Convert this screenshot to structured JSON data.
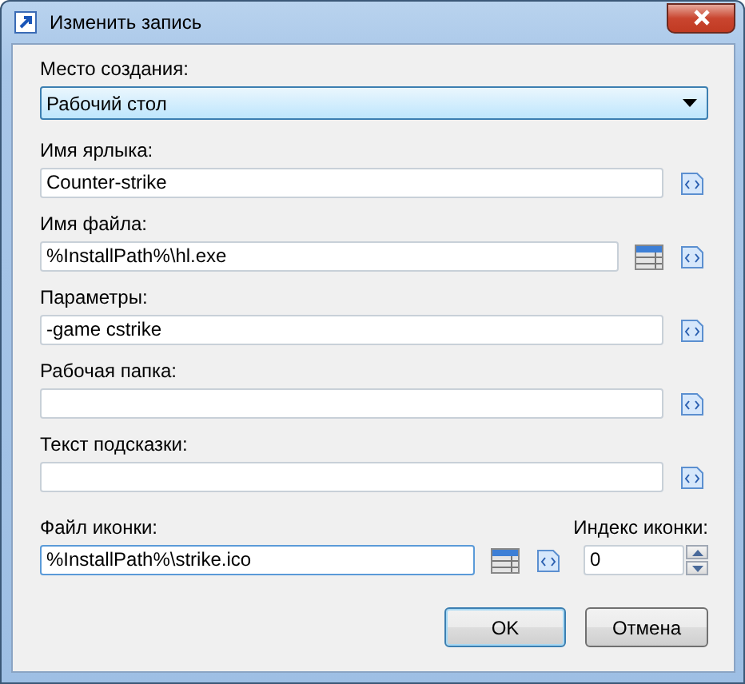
{
  "window": {
    "title": "Изменить запись"
  },
  "location": {
    "label": "Место создания:",
    "value": "Рабочий стол"
  },
  "fields": [
    {
      "label": "Имя ярлыка:",
      "value": "Counter-strike",
      "browse": false,
      "focused": false
    },
    {
      "label": "Имя файла:",
      "value": "%InstallPath%\\hl.exe",
      "browse": true,
      "focused": false
    },
    {
      "label": "Параметры:",
      "value": "-game cstrike",
      "browse": false,
      "focused": false
    },
    {
      "label": "Рабочая папка:",
      "browse": false,
      "focused": false
    },
    {
      "label": "Текст подсказки:",
      "browse": false,
      "focused": false
    }
  ],
  "icon_file": {
    "label": "Файл иконки:",
    "value": "%InstallPath%\\strike.ico",
    "browse": true,
    "focused": true
  },
  "icon_index": {
    "label": "Индекс иконки:",
    "value": "0"
  },
  "buttons": [
    {
      "label": "OK",
      "default": true
    },
    {
      "label": "Отмена",
      "default": false
    }
  ]
}
